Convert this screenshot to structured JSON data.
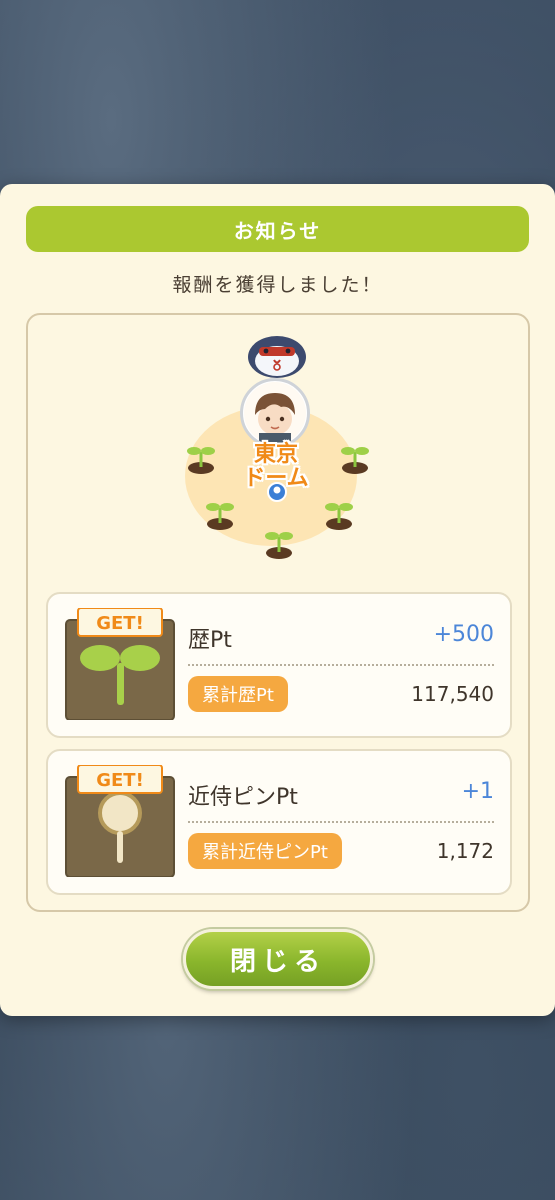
{
  "dialog": {
    "title": "お知らせ",
    "message": "報酬を獲得しました！",
    "close_label": "閉じる"
  },
  "map": {
    "location_line1": "東京",
    "location_line2": "ドーム"
  },
  "rewards": [
    {
      "badge": "GET!",
      "icon": "sprout-icon",
      "name": "歴Pt",
      "delta": "+500",
      "total_label": "累計歴Pt",
      "total_value": "117,540"
    },
    {
      "badge": "GET!",
      "icon": "magnifier-pin-icon",
      "name": "近侍ピンPt",
      "delta": "+1",
      "total_label": "累計近侍ピンPt",
      "total_value": "1,172"
    }
  ],
  "colors": {
    "title_bar": "#abc830",
    "delta": "#4c86d8",
    "badge": "#f5a840",
    "location": "#f08a18"
  }
}
